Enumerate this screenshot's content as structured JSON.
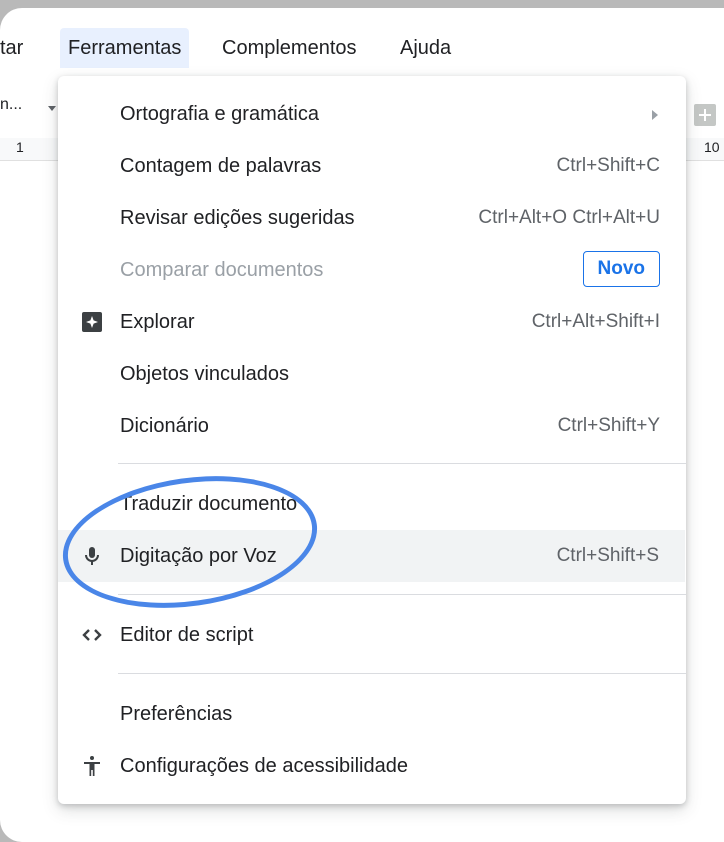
{
  "menubar": {
    "items": [
      {
        "label": "tar"
      },
      {
        "label": "Ferramentas"
      },
      {
        "label": "Complementos"
      },
      {
        "label": "Ajuda"
      }
    ]
  },
  "toolbar": {
    "left_text": "n...",
    "ruler_left": "1",
    "ruler_right": "10"
  },
  "menu": {
    "items": [
      {
        "label": "Ortografia e gramática",
        "shortcut": ""
      },
      {
        "label": "Contagem de palavras",
        "shortcut": "Ctrl+Shift+C"
      },
      {
        "label": "Revisar edições sugeridas",
        "shortcut": "Ctrl+Alt+O Ctrl+Alt+U"
      },
      {
        "label": "Comparar documentos",
        "badge": "Novo"
      },
      {
        "label": "Explorar",
        "shortcut": "Ctrl+Alt+Shift+I"
      },
      {
        "label": "Objetos vinculados",
        "shortcut": ""
      },
      {
        "label": "Dicionário",
        "shortcut": "Ctrl+Shift+Y"
      },
      {
        "label": "Traduzir documento",
        "shortcut": ""
      },
      {
        "label": "Digitação por Voz",
        "shortcut": "Ctrl+Shift+S"
      },
      {
        "label": "Editor de script",
        "shortcut": ""
      },
      {
        "label": "Preferências",
        "shortcut": ""
      },
      {
        "label": "Configurações de acessibilidade",
        "shortcut": ""
      }
    ]
  },
  "icons": {
    "explore": "explore-icon",
    "mic": "microphone-icon",
    "code": "code-icon",
    "accessibility": "accessibility-icon"
  },
  "colors": {
    "accent": "#1a73e8",
    "annotation": "#4a86e8",
    "highlight": "#f1f3f4"
  }
}
